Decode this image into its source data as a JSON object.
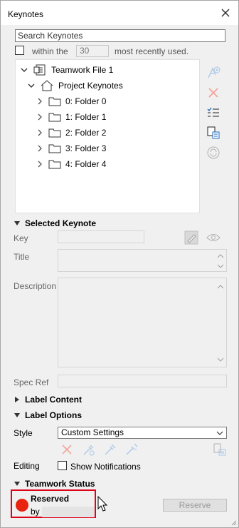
{
  "window": {
    "title": "Keynotes"
  },
  "search": {
    "placeholder": "Search Keynotes"
  },
  "recent": {
    "prefix": "within the",
    "count": "30",
    "suffix": "most recently used."
  },
  "tree": {
    "root": "Teamwork File 1",
    "project": "Project Keynotes",
    "folders": [
      "0: Folder 0",
      "1: Folder 1",
      "2: Folder 2",
      "3: Folder 3",
      "4: Folder 4"
    ]
  },
  "selected_keynote": {
    "header": "Selected Keynote",
    "key_label": "Key",
    "title_label": "Title",
    "description_label": "Description",
    "spec_ref_label": "Spec Ref"
  },
  "label_content": {
    "header": "Label Content"
  },
  "label_options": {
    "header": "Label Options",
    "style_label": "Style",
    "style_value": "Custom Settings",
    "editing_label": "Editing",
    "show_notifications": "Show Notifications"
  },
  "teamwork_status": {
    "header": "Teamwork Status",
    "status": "Reserved",
    "by_label": "by",
    "reserve_button": "Reserve",
    "status_color": "#e8230f"
  }
}
